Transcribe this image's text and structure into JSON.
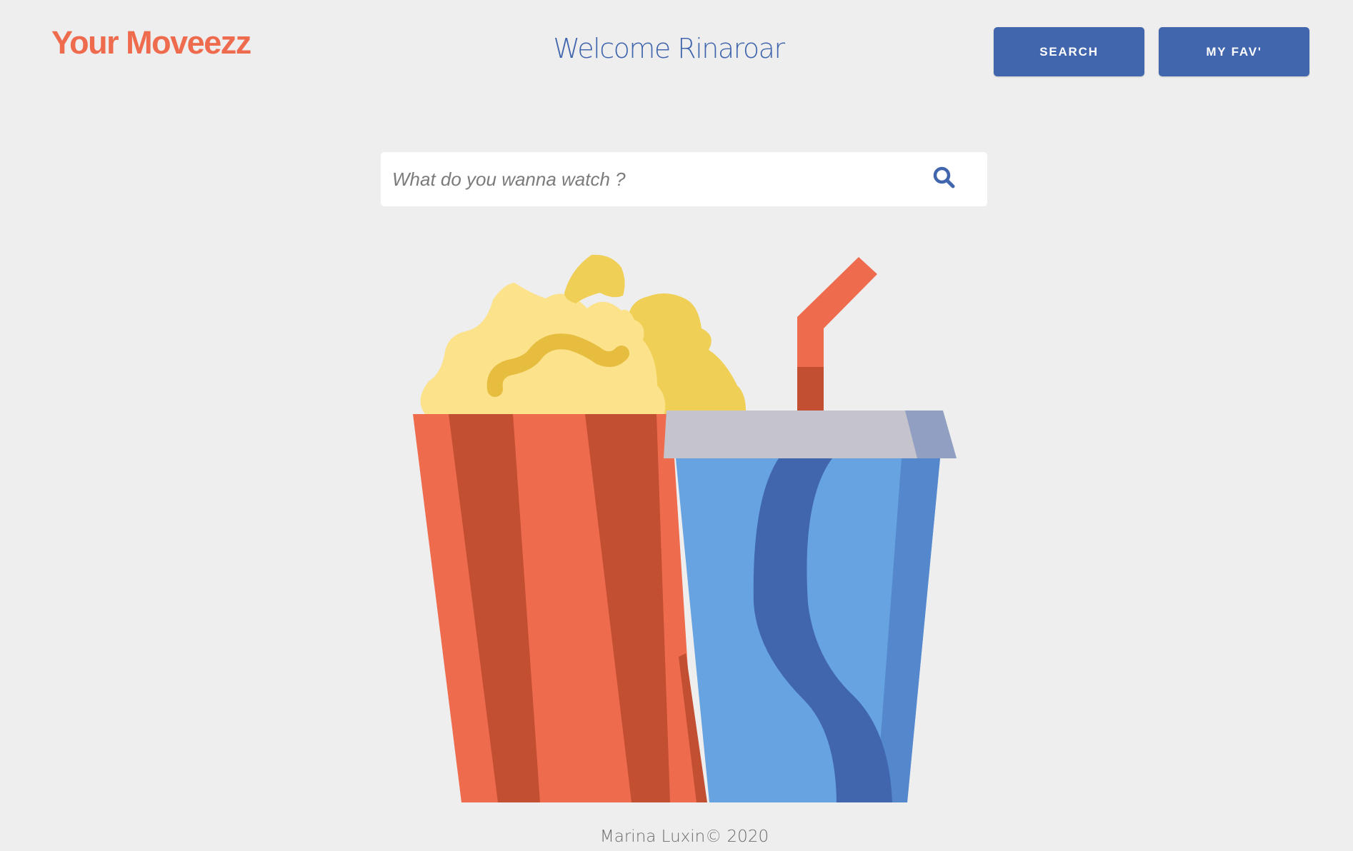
{
  "header": {
    "logo_text": "Your Moveezz",
    "welcome_text": "Welcome Rinaroar",
    "search_button_label": "SEARCH",
    "favorites_button_label": "MY FAV'"
  },
  "search": {
    "placeholder": "What do you wanna watch ?",
    "value": "",
    "icon": "search-icon"
  },
  "illustration": {
    "subject": "popcorn-bucket-and-soda-cup"
  },
  "footer": {
    "text": "Marina Luxin© 2020"
  },
  "colors": {
    "background": "#eeeeee",
    "accent_orange": "#ef6b4e",
    "brand_blue": "#4166ae",
    "popcorn_yellow": "#fce28a",
    "cup_blue": "#66a3e0"
  }
}
